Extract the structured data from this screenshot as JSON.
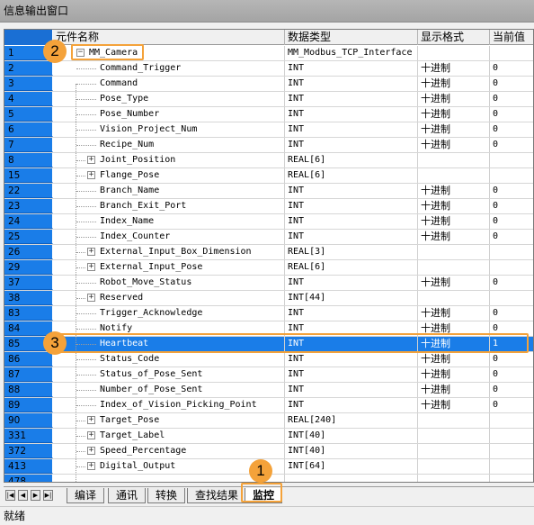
{
  "window": {
    "title": "信息输出窗口"
  },
  "columns": {
    "name": "元件名称",
    "type": "数据类型",
    "format": "显示格式",
    "value": "当前值"
  },
  "rows": [
    {
      "idx": "1",
      "name": "MM_Camera",
      "type": "MM_Modbus_TCP_Interface",
      "format": "",
      "value": "",
      "level": 0,
      "expander": "minus"
    },
    {
      "idx": "2",
      "name": "Command_Trigger",
      "type": "INT",
      "format": "十进制",
      "value": "0",
      "level": 1,
      "expander": ""
    },
    {
      "idx": "3",
      "name": "Command",
      "type": "INT",
      "format": "十进制",
      "value": "0",
      "level": 1,
      "expander": ""
    },
    {
      "idx": "4",
      "name": "Pose_Type",
      "type": "INT",
      "format": "十进制",
      "value": "0",
      "level": 1,
      "expander": ""
    },
    {
      "idx": "5",
      "name": "Pose_Number",
      "type": "INT",
      "format": "十进制",
      "value": "0",
      "level": 1,
      "expander": ""
    },
    {
      "idx": "6",
      "name": "Vision_Project_Num",
      "type": "INT",
      "format": "十进制",
      "value": "0",
      "level": 1,
      "expander": ""
    },
    {
      "idx": "7",
      "name": "Recipe_Num",
      "type": "INT",
      "format": "十进制",
      "value": "0",
      "level": 1,
      "expander": ""
    },
    {
      "idx": "8",
      "name": "Joint_Position",
      "type": "REAL[6]",
      "format": "",
      "value": "",
      "level": 1,
      "expander": "plus"
    },
    {
      "idx": "15",
      "name": "Flange_Pose",
      "type": "REAL[6]",
      "format": "",
      "value": "",
      "level": 1,
      "expander": "plus"
    },
    {
      "idx": "22",
      "name": "Branch_Name",
      "type": "INT",
      "format": "十进制",
      "value": "0",
      "level": 1,
      "expander": ""
    },
    {
      "idx": "23",
      "name": "Branch_Exit_Port",
      "type": "INT",
      "format": "十进制",
      "value": "0",
      "level": 1,
      "expander": ""
    },
    {
      "idx": "24",
      "name": "Index_Name",
      "type": "INT",
      "format": "十进制",
      "value": "0",
      "level": 1,
      "expander": ""
    },
    {
      "idx": "25",
      "name": "Index_Counter",
      "type": "INT",
      "format": "十进制",
      "value": "0",
      "level": 1,
      "expander": ""
    },
    {
      "idx": "26",
      "name": "External_Input_Box_Dimension",
      "type": "REAL[3]",
      "format": "",
      "value": "",
      "level": 1,
      "expander": "plus"
    },
    {
      "idx": "29",
      "name": "External_Input_Pose",
      "type": "REAL[6]",
      "format": "",
      "value": "",
      "level": 1,
      "expander": "plus"
    },
    {
      "idx": "37",
      "name": "Robot_Move_Status",
      "type": "INT",
      "format": "十进制",
      "value": "0",
      "level": 1,
      "expander": ""
    },
    {
      "idx": "38",
      "name": "Reserved",
      "type": "INT[44]",
      "format": "",
      "value": "",
      "level": 1,
      "expander": "plus"
    },
    {
      "idx": "83",
      "name": "Trigger_Acknowledge",
      "type": "INT",
      "format": "十进制",
      "value": "0",
      "level": 1,
      "expander": ""
    },
    {
      "idx": "84",
      "name": "Notify",
      "type": "INT",
      "format": "十进制",
      "value": "0",
      "level": 1,
      "expander": ""
    },
    {
      "idx": "85",
      "name": "Heartbeat",
      "type": "INT",
      "format": "十进制",
      "value": "1",
      "level": 1,
      "expander": "",
      "selected": true
    },
    {
      "idx": "86",
      "name": "Status_Code",
      "type": "INT",
      "format": "十进制",
      "value": "0",
      "level": 1,
      "expander": ""
    },
    {
      "idx": "87",
      "name": "Status_of_Pose_Sent",
      "type": "INT",
      "format": "十进制",
      "value": "0",
      "level": 1,
      "expander": ""
    },
    {
      "idx": "88",
      "name": "Number_of_Pose_Sent",
      "type": "INT",
      "format": "十进制",
      "value": "0",
      "level": 1,
      "expander": ""
    },
    {
      "idx": "89",
      "name": "Index_of_Vision_Picking_Point",
      "type": "INT",
      "format": "十进制",
      "value": "0",
      "level": 1,
      "expander": ""
    },
    {
      "idx": "90",
      "name": "Target_Pose",
      "type": "REAL[240]",
      "format": "",
      "value": "",
      "level": 1,
      "expander": "plus"
    },
    {
      "idx": "331",
      "name": "Target_Label",
      "type": "INT[40]",
      "format": "",
      "value": "",
      "level": 1,
      "expander": "plus"
    },
    {
      "idx": "372",
      "name": "Speed_Percentage",
      "type": "INT[40]",
      "format": "",
      "value": "",
      "level": 1,
      "expander": "plus"
    },
    {
      "idx": "413",
      "name": "Digital_Output",
      "type": "INT[64]",
      "format": "",
      "value": "",
      "level": 1,
      "expander": "plus"
    },
    {
      "idx": "478",
      "name": "",
      "type": "",
      "format": "",
      "value": "",
      "level": 1,
      "expander": ""
    }
  ],
  "tabs": [
    {
      "label": "编译",
      "active": false
    },
    {
      "label": "通讯",
      "active": false
    },
    {
      "label": "转换",
      "active": false
    },
    {
      "label": "查找结果",
      "active": false
    },
    {
      "label": "监控",
      "active": true
    }
  ],
  "nav": [
    "first",
    "prev",
    "next",
    "last"
  ],
  "annotations": [
    "1",
    "2",
    "3"
  ],
  "status": {
    "text": "就绪"
  },
  "colors": {
    "selection": "#1a7de8",
    "callout": "#f4a23a"
  }
}
